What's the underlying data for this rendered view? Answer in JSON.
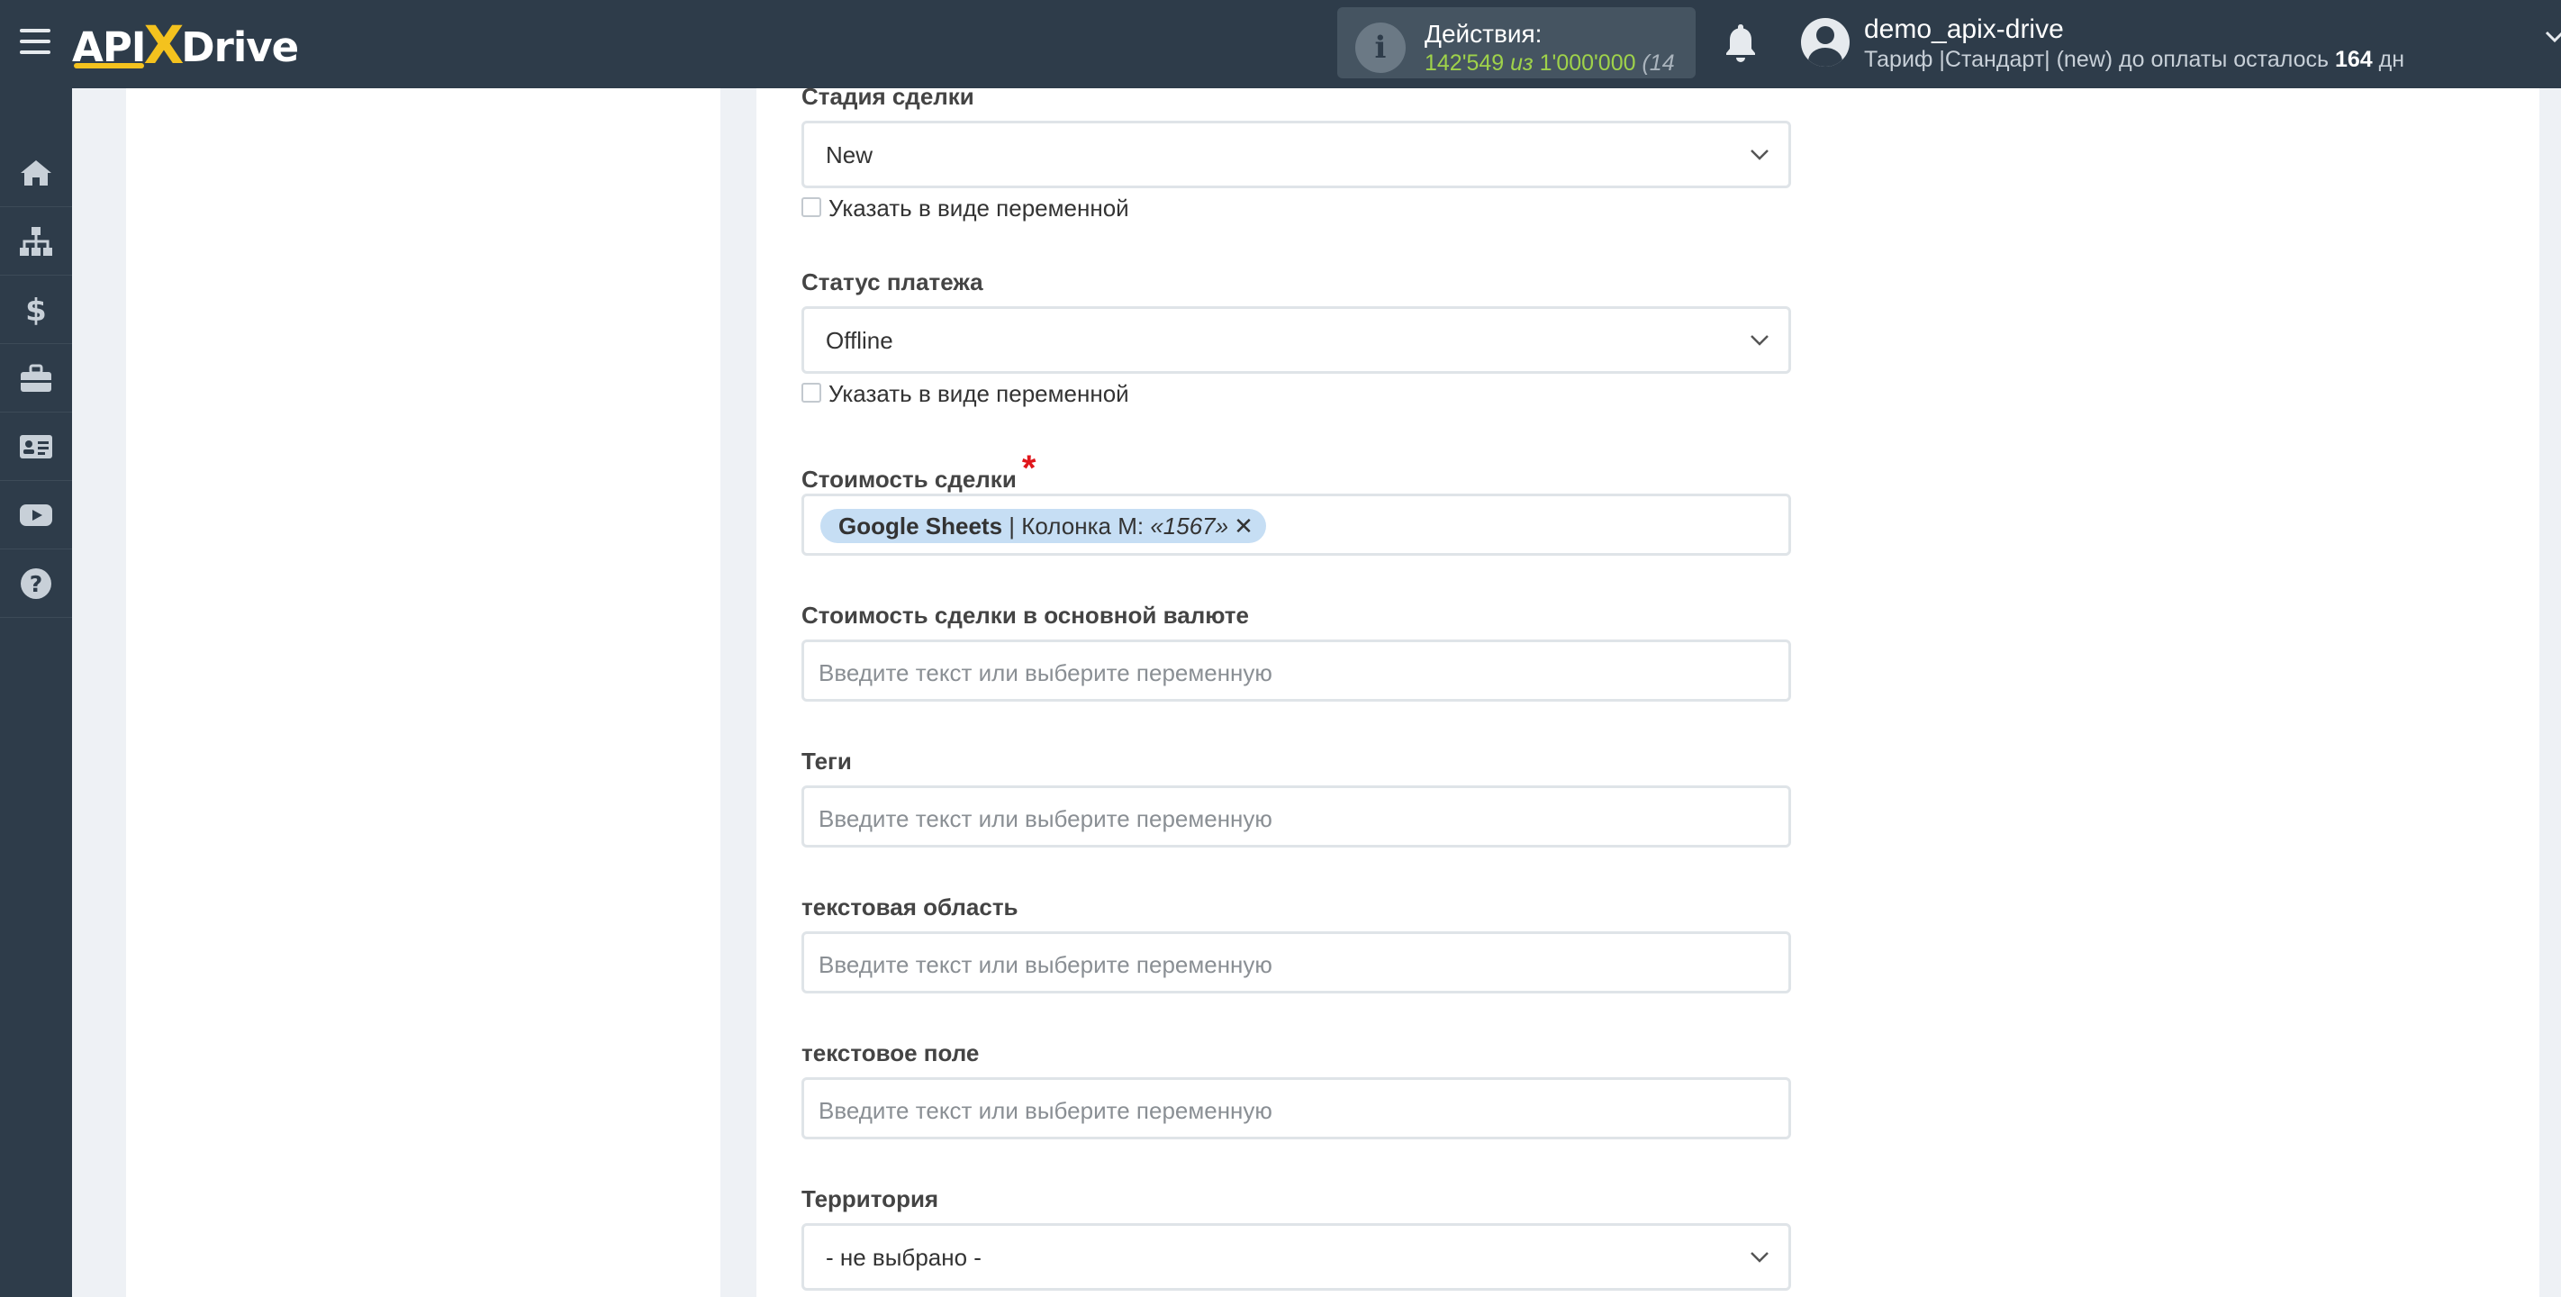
{
  "header": {
    "logo": {
      "api": "API",
      "x": "X",
      "drive": "Drive"
    },
    "actions": {
      "label": "Действия:",
      "used": "142'549",
      "of": "из",
      "total": "1'000'000",
      "extra": "(14"
    },
    "user": {
      "name": "demo_apix-drive",
      "tariff_prefix": "Тариф |Стандарт| (new) до оплаты осталось",
      "days": "164",
      "days_suffix": "дн"
    }
  },
  "sidebar": {
    "items": [
      {
        "icon": "home-icon"
      },
      {
        "icon": "sitemap-icon"
      },
      {
        "icon": "dollar-icon"
      },
      {
        "icon": "briefcase-icon"
      },
      {
        "icon": "id-card-icon"
      },
      {
        "icon": "youtube-icon"
      },
      {
        "icon": "help-icon"
      }
    ]
  },
  "form": {
    "deal_stage": {
      "label": "Стадия сделки",
      "value": "New",
      "checkbox": "Указать в виде переменной"
    },
    "payment_status": {
      "label": "Статус платежа",
      "value": "Offline",
      "checkbox": "Указать в виде переменной"
    },
    "deal_cost": {
      "label": "Стоимость сделки",
      "required_mark": "*",
      "tag": {
        "source": "Google Sheets",
        "sep": " | Колонка M: ",
        "value": "«1567»",
        "remove": "✕"
      }
    },
    "deal_cost_base": {
      "label": "Стоимость сделки в основной валюте",
      "placeholder": "Введите текст или выберите переменную"
    },
    "tags": {
      "label": "Теги",
      "placeholder": "Введите текст или выберите переменную"
    },
    "text_area": {
      "label": "текстовая область",
      "placeholder": "Введите текст или выберите переменную"
    },
    "text_field": {
      "label": "текстовое поле",
      "placeholder": "Введите текст или выберите переменную"
    },
    "territory": {
      "label": "Территория",
      "value": "- не выбрано -"
    }
  },
  "colors": {
    "topbar": "#2e3c4a",
    "accent_yellow": "#f4c21e",
    "count_green": "#9fd24a",
    "tag_bg": "#c6def4",
    "required_red": "#e0171c"
  }
}
